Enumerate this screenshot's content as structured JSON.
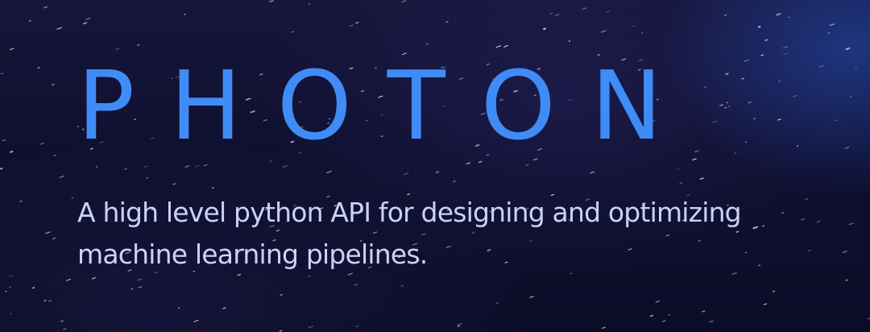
{
  "hero": {
    "title": "PHOTON",
    "tagline": "A high level python API for designing and optimizing machine learning pipelines."
  },
  "colors": {
    "background": "#0f1030",
    "title": "#3f8cf6",
    "tagline": "#c9d2f8",
    "star": "#ffffff"
  }
}
